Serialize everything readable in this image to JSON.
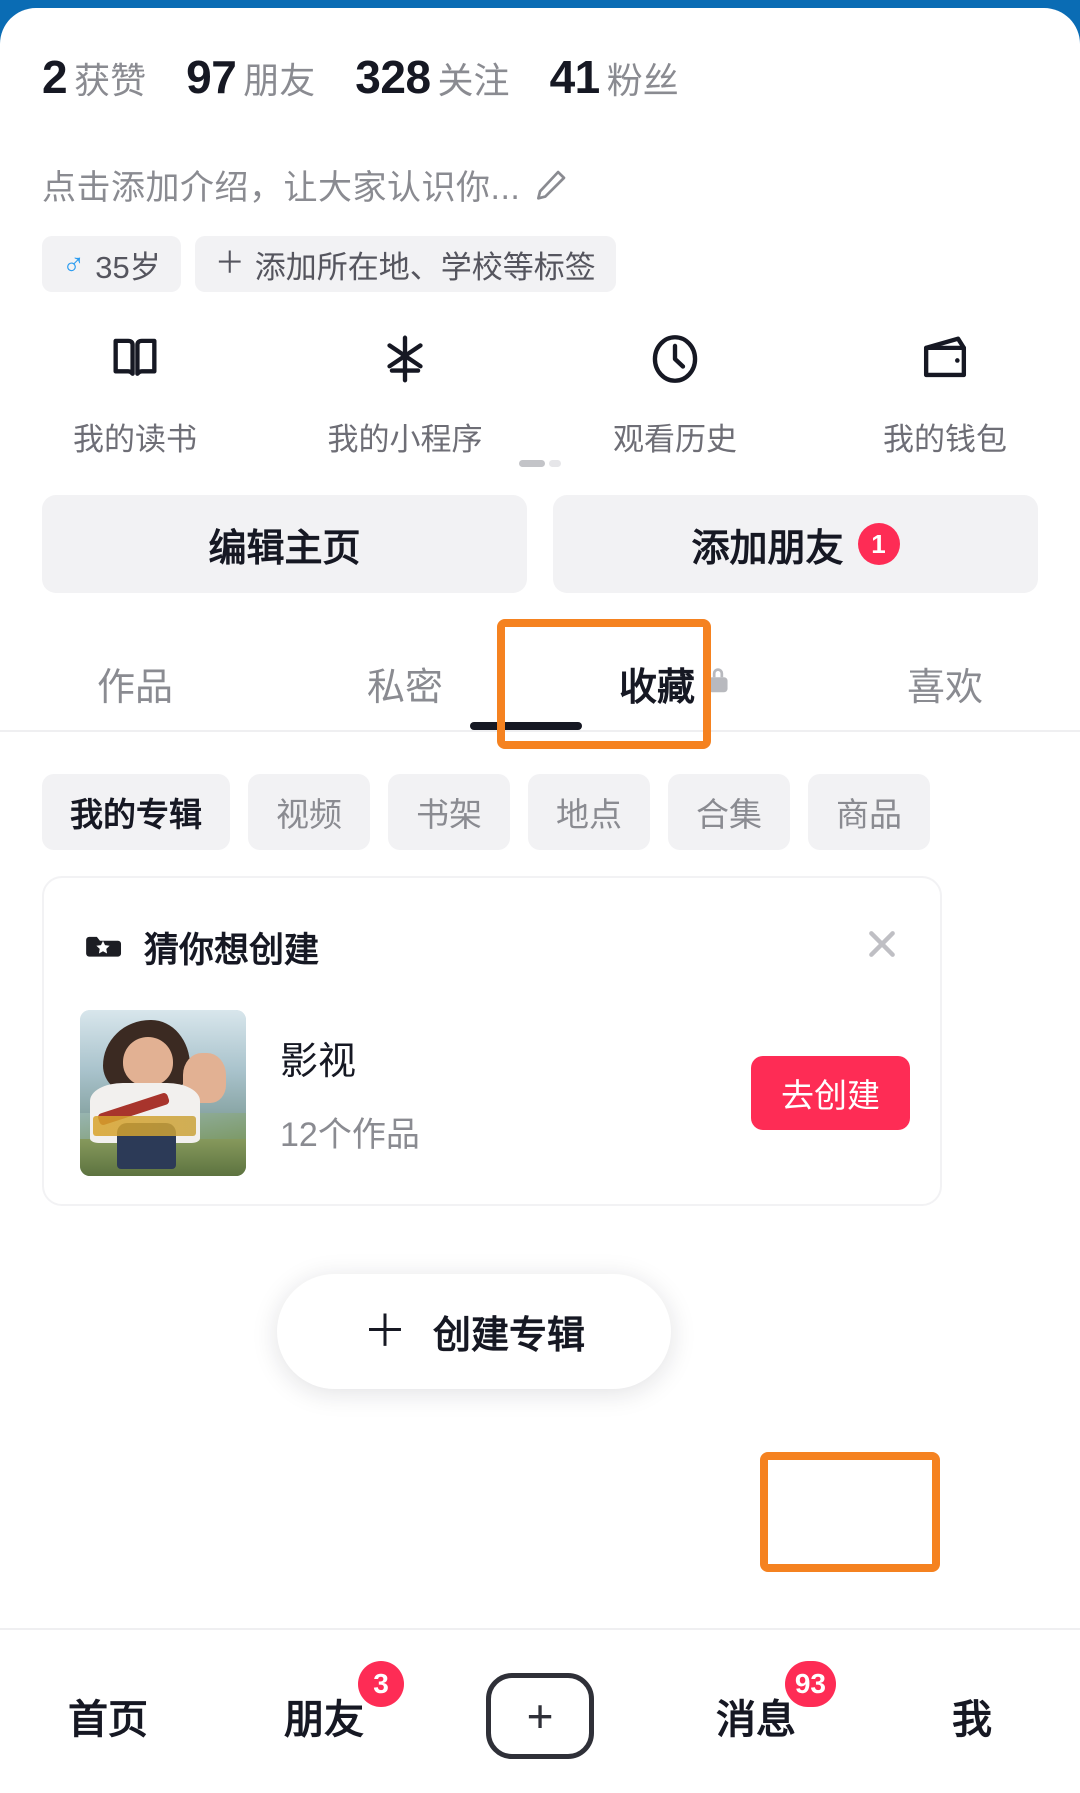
{
  "theme": {
    "accent_red": "#fe2c55",
    "highlight_orange": "#f58220",
    "text_primary": "#161823",
    "text_secondary": "#8a8b91",
    "chip_bg": "#f2f2f4",
    "status_blue": "#0a6cb4"
  },
  "stats": [
    {
      "number": "2",
      "label": "获赞"
    },
    {
      "number": "97",
      "label": "朋友"
    },
    {
      "number": "328",
      "label": "关注"
    },
    {
      "number": "41",
      "label": "粉丝"
    }
  ],
  "bio": {
    "text": "点击添加介绍，让大家认识你...",
    "edit_icon": "pencil-icon"
  },
  "tags": [
    {
      "icon": "male-icon",
      "glyph": "♂",
      "label": "35岁"
    },
    {
      "icon": "plus-icon",
      "glyph": "＋",
      "label": "添加所在地、学校等标签"
    }
  ],
  "entries": [
    {
      "icon": "book-icon",
      "label": "我的读书"
    },
    {
      "icon": "mini-program-icon",
      "label": "我的小程序"
    },
    {
      "icon": "clock-icon",
      "label": "观看历史"
    },
    {
      "icon": "wallet-icon",
      "label": "我的钱包"
    }
  ],
  "actions": {
    "edit_profile": "编辑主页",
    "add_friend": "添加朋友",
    "add_friend_badge": "1"
  },
  "tabs": [
    {
      "label": "作品",
      "active": false,
      "locked": false
    },
    {
      "label": "私密",
      "active": false,
      "locked": false
    },
    {
      "label": "收藏",
      "active": true,
      "locked": true
    },
    {
      "label": "喜欢",
      "active": false,
      "locked": false
    }
  ],
  "chips": [
    {
      "label": "我的专辑",
      "active": true
    },
    {
      "label": "视频",
      "active": false
    },
    {
      "label": "书架",
      "active": false
    },
    {
      "label": "地点",
      "active": false
    },
    {
      "label": "合集",
      "active": false
    },
    {
      "label": "商品",
      "active": false
    }
  ],
  "suggestion_card": {
    "title": "猜你想创建",
    "folder_icon": "folder-star-icon",
    "close_icon": "close-icon",
    "item_name": "影视",
    "item_count": "12个作品",
    "cta_label": "去创建"
  },
  "create_album": {
    "plus": "＋",
    "label": "创建专辑"
  },
  "bottom_nav": [
    {
      "label": "首页",
      "badge": "",
      "type": "text",
      "active": false
    },
    {
      "label": "朋友",
      "badge": "3",
      "type": "text",
      "active": false
    },
    {
      "label": "",
      "badge": "",
      "type": "plus",
      "active": false,
      "icon": "plus-box-icon"
    },
    {
      "label": "消息",
      "badge": "93",
      "type": "text",
      "active": false
    },
    {
      "label": "我",
      "badge": "",
      "type": "text",
      "active": true
    }
  ]
}
